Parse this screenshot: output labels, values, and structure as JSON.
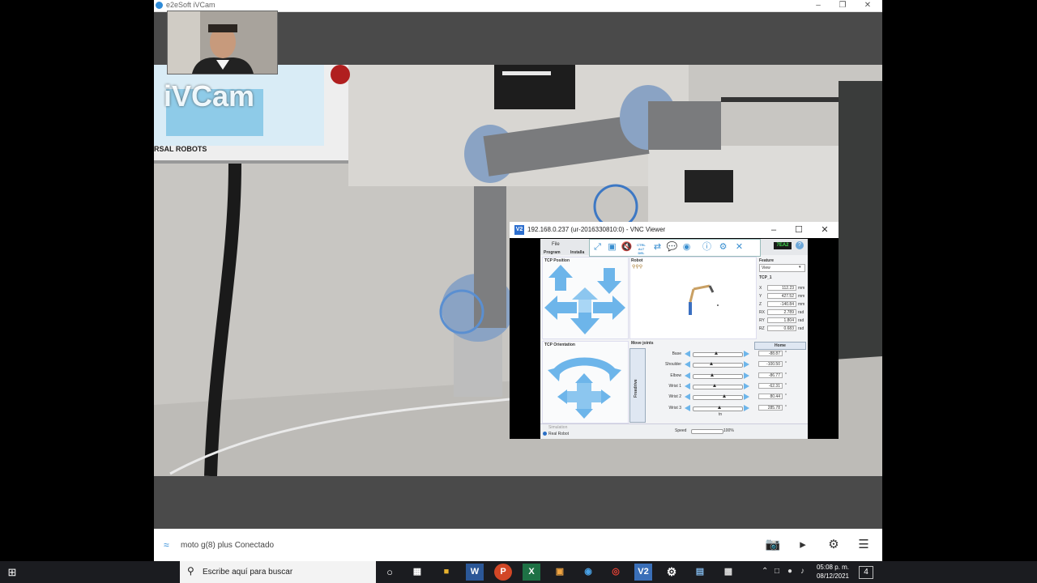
{
  "ivcam": {
    "title": "e2eSoft iVCam",
    "overlay_logo": "iVCam",
    "monitor_brand": "RSAL ROBOTS",
    "status_text": "moto g(8) plus Conectado"
  },
  "vnc": {
    "title": "192.168.0.237 (ur-2016330810:0) - VNC Viewer",
    "toolbar": {
      "ctrl_alt_del": "CTRL ALT DEL"
    },
    "pendant": {
      "menu_file": "File",
      "tabs": [
        "Program",
        "Installa"
      ],
      "tcp_position_label": "TCP Position",
      "tcp_orientation_label": "TCP Orientation",
      "robot_label": "Robot",
      "feature_label": "Feature",
      "feature_value": "View",
      "tcp_name": "TCP_1",
      "move_joints_label": "Move joints",
      "home_button": "Home",
      "freedrive_button": "Freedrive",
      "badge": "7EA2",
      "tcp_values": [
        {
          "axis": "X",
          "value": "112.23",
          "unit": "mm"
        },
        {
          "axis": "Y",
          "value": "427.52",
          "unit": "mm"
        },
        {
          "axis": "Z",
          "value": "-140.84",
          "unit": "mm"
        },
        {
          "axis": "RX",
          "value": "2.789",
          "unit": "rad"
        },
        {
          "axis": "RY",
          "value": "1.804",
          "unit": "rad"
        },
        {
          "axis": "RZ",
          "value": "0.683",
          "unit": "rad"
        }
      ],
      "joints": [
        {
          "name": "Base",
          "value": "-88.87",
          "pos": 0.45
        },
        {
          "name": "Shoulder",
          "value": "-100.50",
          "pos": 0.35
        },
        {
          "name": "Elbow",
          "value": "-86.77",
          "pos": 0.36
        },
        {
          "name": "Wrist 1",
          "value": "-62.31",
          "pos": 0.42
        },
        {
          "name": "Wrist 2",
          "value": "80.44",
          "pos": 0.62
        },
        {
          "name": "Wrist 3",
          "value": "285.78",
          "pos": 0.52
        }
      ],
      "simulation_label": "Simulation",
      "real_robot_label": "Real Robot",
      "speed_label": "Speed",
      "speed_value": "100%",
      "tcp_note": "tn"
    }
  },
  "taskbar": {
    "search_placeholder": "Escribe aquí para buscar",
    "time": "05:08 p. m.",
    "date": "08/12/2021",
    "notification_count": "4"
  },
  "colors": {
    "accent_blue": "#6db5ea",
    "taskbar_bg": "#1b1c20",
    "ivcam_bg": "#4a4a4a"
  }
}
